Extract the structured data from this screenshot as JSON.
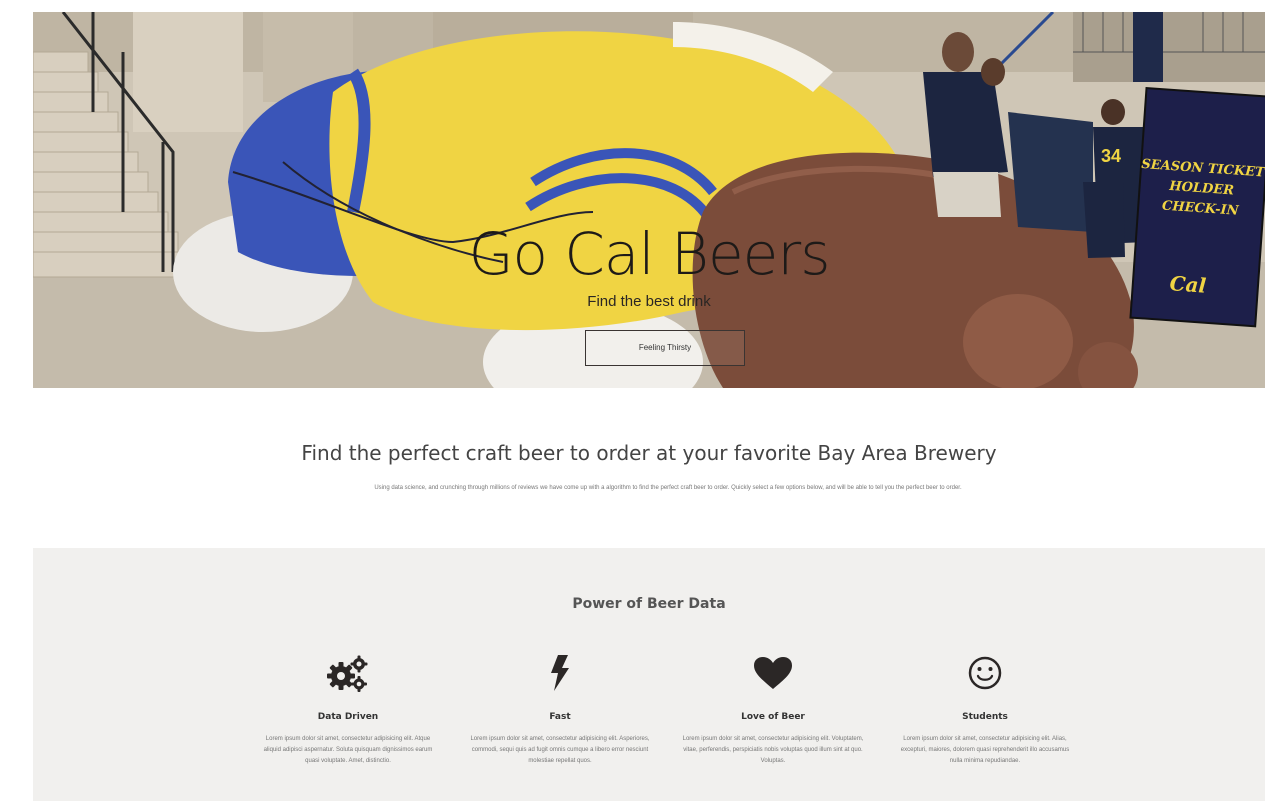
{
  "hero": {
    "title": "Go Cal Beers",
    "subtitle": "Find the best drink",
    "button_label": "Feeling Thirsty",
    "sign_lines": [
      "SEASON TICKET",
      "HOLDER",
      "CHECK-IN"
    ],
    "sign_logo": "Cal",
    "jersey_number": "34"
  },
  "intro": {
    "heading": "Find the perfect craft beer to order at your favorite Bay Area Brewery",
    "text": "Using data science, and crunching through millions of reviews we have come up with a algorithm to find the perfect craft beer to order. Quickly select a few options below, and will be able to tell you the perfect beer to order."
  },
  "features": {
    "heading": "Power of Beer Data",
    "items": [
      {
        "icon": "gears-icon",
        "title": "Data Driven",
        "text": "Lorem ipsum dolor sit amet, consectetur adipisicing elit. Atque aliquid adipisci aspernatur. Soluta quisquam dignissimos earum quasi voluptate. Amet, distinctio."
      },
      {
        "icon": "lightning-bolt-icon",
        "title": "Fast",
        "text": "Lorem ipsum dolor sit amet, consectetur adipisicing elit. Asperiores, commodi, sequi quis ad fugit omnis cumque a libero error nesciunt molestiae repellat quos."
      },
      {
        "icon": "heart-icon",
        "title": "Love of Beer",
        "text": "Lorem ipsum dolor sit amet, consectetur adipisicing elit. Voluptatem, vitae, perferendis, perspiciatis nobis voluptas quod illum sint at quo. Voluptas."
      },
      {
        "icon": "smiley-face-icon",
        "title": "Students",
        "text": "Lorem ipsum dolor sit amet, consectetur adipisicing elit. Alias, excepturi, maiores, dolorem quasi reprehenderit illo accusamus nulla minima repudiandae."
      }
    ]
  },
  "colors": {
    "cal_blue": "#1d2a5e",
    "cal_gold": "#f2d53c",
    "bear_brown": "#7a4a38",
    "features_bg": "#f1f0ee"
  }
}
